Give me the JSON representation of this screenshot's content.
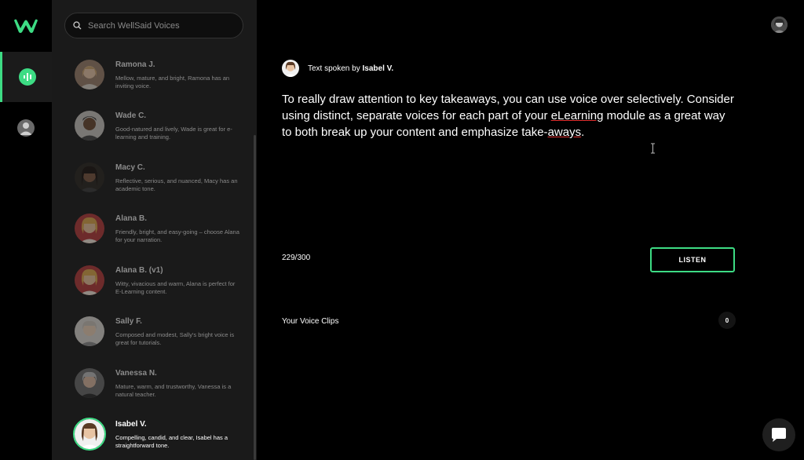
{
  "search": {
    "placeholder": "Search WellSaid Voices"
  },
  "voices": [
    {
      "name": "Ramona J.",
      "description": "Mellow, mature, and bright, Ramona has an inviting voice."
    },
    {
      "name": "Wade C.",
      "description": "Good-natured and lively, Wade is great for e-learning and training."
    },
    {
      "name": "Macy C.",
      "description": "Reflective, serious, and nuanced, Macy has an academic tone."
    },
    {
      "name": "Alana B.",
      "description": "Friendly, bright, and easy-going – choose Alana for your narration."
    },
    {
      "name": "Alana B. (v1)",
      "description": "Witty, vivacious and warm, Alana is perfect for E-Learning content."
    },
    {
      "name": "Sally F.",
      "description": "Composed and modest, Sally's bright voice is great for tutorials."
    },
    {
      "name": "Vanessa N.",
      "description": "Mature, warm, and trustworthy, Vanessa is a natural teacher."
    },
    {
      "name": "Isabel V.",
      "description": "Compelling, candid, and clear, Isabel has a straightforward tone.",
      "selected": true
    }
  ],
  "editor": {
    "spoken_by_prefix": "Text spoken by",
    "speaker_name": "Isabel V.",
    "text_part1": "To really draw attention to key takeaways, you can use voice over selectively. Consider using distinct, separate voices for each part of your ",
    "text_flag1": "eLearning",
    "text_part2": " module as a great way to both break up your content and emphasize take-",
    "text_flag2": "aways",
    "text_part3": ".",
    "char_count": "229/300",
    "listen_label": "LISTEN"
  },
  "clips": {
    "title": "Your Voice Clips",
    "count": "0"
  },
  "colors": {
    "accent": "#3ddc84",
    "background": "#000000",
    "panel": "#1a1a1a",
    "spellcheck": "#e03030"
  },
  "icons": [
    "wellsaid-logo-icon",
    "voices-nav-icon",
    "account-nav-icon",
    "search-icon",
    "user-avatar",
    "text-cursor-icon",
    "chat-icon"
  ]
}
